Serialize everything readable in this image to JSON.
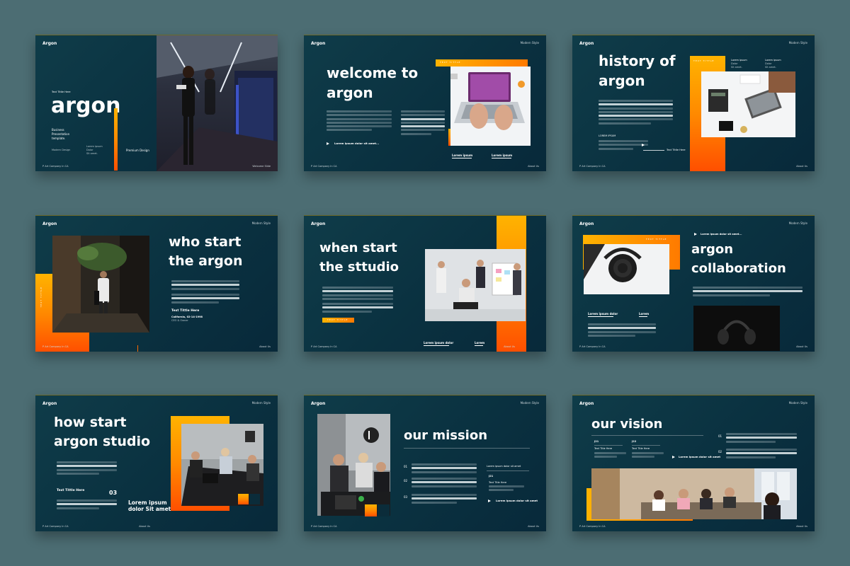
{
  "brand": "Argon",
  "tag": "Modern Style",
  "footer_left": "P Art Company In CA",
  "footer_right": "About Us",
  "s1": {
    "title": "argon",
    "kicker": "Text Tittle Here",
    "sub1": "Business",
    "sub2": "Presentation",
    "sub3": "template.",
    "note1": "Modern Design",
    "lorem1": "Lorem ipsum",
    "lorem2": "Dolor",
    "lorem3": "Sit amet.",
    "premium": "Premium Design",
    "corner": "Welcome Slide"
  },
  "s2": {
    "title1": "welcome to",
    "title2": "argon",
    "link": "Lorem ipsum dolor sit amet...",
    "lbl1": "Lorem ipsum",
    "lbl2": "Lorem ipsum",
    "badge": "TEXT TITTLE"
  },
  "s3": {
    "title1": "history of",
    "title2": "argon",
    "side": "TEXT TITTLE",
    "tag": "Text Tittle Here",
    "label": "LOREM IPSUM",
    "info1a": "Lorem ipsum",
    "info1b": "Dolor",
    "info1c": "Sit amet.",
    "info2a": "Lorem ipsum",
    "info2b": "Dolor",
    "info2c": "Sit amet."
  },
  "s4": {
    "title1": "who start",
    "title2": "the argon",
    "vert": "TEXT TITTLE",
    "name": "Text Tittle Here",
    "loc": "California, 02-14-1998",
    "role": "CEO & Owner"
  },
  "s5": {
    "title1": "when start",
    "title2": "the sttudio",
    "badge": "TEXT TITTLE",
    "lbl1": "Lorem ipsum dolor",
    "lbl2": "Lorem"
  },
  "s6": {
    "title1": "argon",
    "title2": "collaboration",
    "top": "Lorem ipsum dolor sit amet...",
    "badge": "TEXT TITTLE",
    "lbl1": "Lorem ipsum dolor",
    "lbl2": "Lorem"
  },
  "s7": {
    "title1": "how start",
    "title2": "argon studio",
    "name": "Text Tittle Here",
    "num": "03",
    "quote1": "Lorem ipsum",
    "quote2": "dolor Sit amet"
  },
  "s8": {
    "title": "our mission",
    "n1": "01",
    "n2": "02",
    "n3": "03",
    "right1": "Lorem ipsum dolor sit amet",
    "year": "J21",
    "rightlbl": "Text Title Here",
    "link": "Lorem ipsum dolor sit amet"
  },
  "s9": {
    "title": "our vision",
    "y1": "J21",
    "y2": "J22",
    "t1": "Text Title Here",
    "t2": "Text Title Here",
    "n1": "01",
    "n2": "02",
    "link": "Lorem ipsum dolor sit amet"
  }
}
